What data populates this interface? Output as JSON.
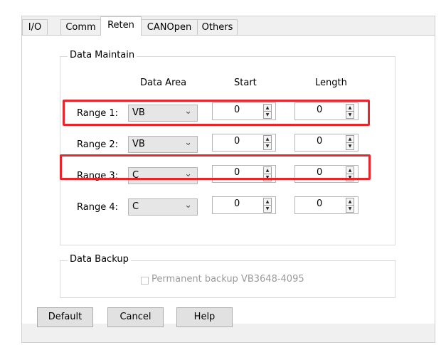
{
  "tabs": [
    {
      "label": "I/O"
    },
    {
      "label": "Comm"
    },
    {
      "label": "Reten"
    },
    {
      "label": "CANOpen"
    },
    {
      "label": "Others"
    }
  ],
  "active_tab": "Reten",
  "data_maintain": {
    "title": "Data Maintain",
    "headers": {
      "area": "Data Area",
      "start": "Start",
      "length": "Length"
    },
    "rows": [
      {
        "label": "Range 1:",
        "area": "VB",
        "start": "0",
        "length": "0",
        "highlighted": true
      },
      {
        "label": "Range 2:",
        "area": "VB",
        "start": "0",
        "length": "0",
        "highlighted": false
      },
      {
        "label": "Range 3:",
        "area": "C",
        "start": "0",
        "length": "0",
        "highlighted": true
      },
      {
        "label": "Range 4:",
        "area": "C",
        "start": "0",
        "length": "0",
        "highlighted": false
      }
    ]
  },
  "data_backup": {
    "title": "Data Backup",
    "checkbox_label": "Permanent backup VB3648-4095",
    "checked": false,
    "enabled": false
  },
  "buttons": {
    "default": "Default",
    "cancel": "Cancel",
    "help": "Help"
  },
  "colors": {
    "highlight": "#e5262c",
    "panel": "#ffffff",
    "dialog": "#f0f0f0"
  }
}
